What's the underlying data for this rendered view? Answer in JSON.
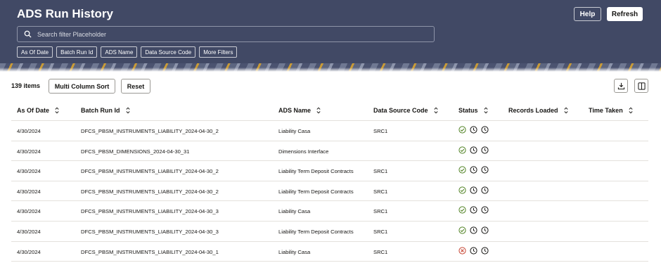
{
  "app": {
    "title": "ADS Run History"
  },
  "header": {
    "help_label": "Help",
    "refresh_label": "Refresh"
  },
  "search": {
    "placeholder": "Search filter Placeholder"
  },
  "filters": [
    "As Of Date",
    "Batch Run Id",
    "ADS Name",
    "Data Source Code",
    "More Filters"
  ],
  "toolbar": {
    "count": "139 items",
    "multi_sort_label": "Multi Column Sort",
    "reset_label": "Reset"
  },
  "colors": {
    "header_bg": "#414965",
    "success": "#508223",
    "error": "#c74634"
  },
  "columns": [
    "As Of Date",
    "Batch Run Id",
    "ADS Name",
    "Data Source Code",
    "Status",
    "Records Loaded",
    "Time Taken"
  ],
  "rows": [
    {
      "date": "4/30/2024",
      "batch": "DFCS_PBSM_INSTRUMENTS_LIABILITY_2024-04-30_2",
      "ads": "Liability Casa",
      "src": "SRC1",
      "status": "success"
    },
    {
      "date": "4/30/2024",
      "batch": "DFCS_PBSM_DIMENSIONS_2024-04-30_31",
      "ads": "Dimensions Interface",
      "src": "",
      "status": "success"
    },
    {
      "date": "4/30/2024",
      "batch": "DFCS_PBSM_INSTRUMENTS_LIABILITY_2024-04-30_2",
      "ads": "Liability Term Deposit Contracts",
      "src": "SRC1",
      "status": "success"
    },
    {
      "date": "4/30/2024",
      "batch": "DFCS_PBSM_INSTRUMENTS_LIABILITY_2024-04-30_2",
      "ads": "Liability Term Deposit Contracts",
      "src": "SRC1",
      "status": "success"
    },
    {
      "date": "4/30/2024",
      "batch": "DFCS_PBSM_INSTRUMENTS_LIABILITY_2024-04-30_3",
      "ads": "Liability Casa",
      "src": "SRC1",
      "status": "success"
    },
    {
      "date": "4/30/2024",
      "batch": "DFCS_PBSM_INSTRUMENTS_LIABILITY_2024-04-30_3",
      "ads": "Liability Term Deposit Contracts",
      "src": "SRC1",
      "status": "success"
    },
    {
      "date": "4/30/2024",
      "batch": "DFCS_PBSM_INSTRUMENTS_LIABILITY_2024-04-30_1",
      "ads": "Liability Casa",
      "src": "SRC1",
      "status": "error"
    }
  ]
}
